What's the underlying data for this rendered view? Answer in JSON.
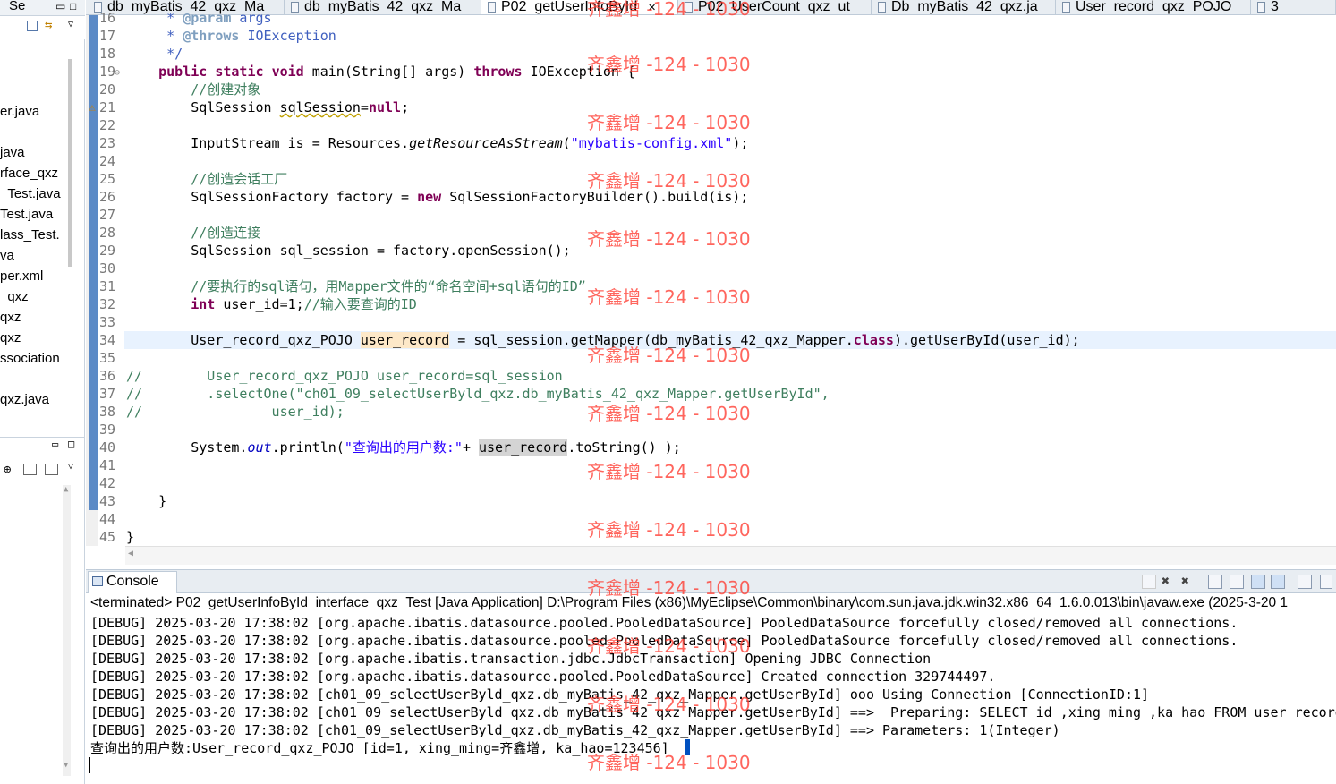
{
  "left_panel": {
    "header": "Se",
    "files": [
      "er.java",
      "",
      "java",
      "rface_qxz",
      "_Test.java",
      "Test.java",
      "lass_Test.",
      "va",
      "per.xml",
      "_qxz",
      "qxz",
      "qxz",
      "ssociation",
      "",
      "qxz.java"
    ]
  },
  "tabs": [
    "db_myBatis_42_qxz_Ma",
    "db_myBatis_42_qxz_Ma",
    "P02_getUserInfoById_",
    "P02_UserCount_qxz_ut",
    "Db_myBatis_42_qxz.ja",
    "User_record_qxz_POJO",
    "3"
  ],
  "editor": {
    "lines": [
      {
        "n": "16",
        "parts": [
          {
            "t": "     * ",
            "c": "jd"
          },
          {
            "t": "@param",
            "c": "jt"
          },
          {
            "t": " args",
            "c": "jd"
          }
        ]
      },
      {
        "n": "17",
        "parts": [
          {
            "t": "     * ",
            "c": "jd"
          },
          {
            "t": "@throws",
            "c": "jt"
          },
          {
            "t": " IOException",
            "c": "jd"
          }
        ]
      },
      {
        "n": "18",
        "parts": [
          {
            "t": "     */",
            "c": "jd"
          }
        ]
      },
      {
        "n": "19",
        "parts": [
          {
            "t": "    "
          },
          {
            "t": "public",
            "c": "kw"
          },
          {
            "t": " "
          },
          {
            "t": "static",
            "c": "kw"
          },
          {
            "t": " "
          },
          {
            "t": "void",
            "c": "kw"
          },
          {
            "t": " main(String[] args) "
          },
          {
            "t": "throws",
            "c": "kw"
          },
          {
            "t": " IOException {"
          }
        ]
      },
      {
        "n": "20",
        "parts": [
          {
            "t": "        //创建对象",
            "c": "cm"
          }
        ]
      },
      {
        "n": "21",
        "parts": [
          {
            "t": "        SqlSession "
          },
          {
            "t": "sqlSession",
            "c": "squig"
          },
          {
            "t": "="
          },
          {
            "t": "null",
            "c": "kw"
          },
          {
            "t": ";"
          }
        ]
      },
      {
        "n": "22",
        "parts": []
      },
      {
        "n": "23",
        "parts": [
          {
            "t": "        InputStream is = Resources."
          },
          {
            "t": "getResourceAsStream",
            "c": "it"
          },
          {
            "t": "("
          },
          {
            "t": "\"mybatis-config.xml\"",
            "c": "st"
          },
          {
            "t": ");"
          }
        ]
      },
      {
        "n": "24",
        "parts": []
      },
      {
        "n": "25",
        "parts": [
          {
            "t": "        //创造会话工厂",
            "c": "cm"
          }
        ]
      },
      {
        "n": "26",
        "parts": [
          {
            "t": "        SqlSessionFactory factory = "
          },
          {
            "t": "new",
            "c": "kw"
          },
          {
            "t": " SqlSessionFactoryBuilder().build(is);"
          }
        ]
      },
      {
        "n": "27",
        "parts": []
      },
      {
        "n": "28",
        "parts": [
          {
            "t": "        //创造连接",
            "c": "cm"
          }
        ]
      },
      {
        "n": "29",
        "parts": [
          {
            "t": "        SqlSession sql_session = factory.openSession();"
          }
        ]
      },
      {
        "n": "30",
        "parts": []
      },
      {
        "n": "31",
        "parts": [
          {
            "t": "        //要执行的sql语句，用Mapper文件的“命名空间+sql语句的ID”",
            "c": "cm"
          }
        ]
      },
      {
        "n": "32",
        "parts": [
          {
            "t": "        "
          },
          {
            "t": "int",
            "c": "kw"
          },
          {
            "t": " user_id=1;"
          },
          {
            "t": "//输入要查询的ID",
            "c": "cm"
          }
        ]
      },
      {
        "n": "33",
        "parts": []
      },
      {
        "n": "34",
        "cur": true,
        "parts": [
          {
            "t": "        User_record_qxz_POJO "
          },
          {
            "t": "user_record",
            "c": "ohl"
          },
          {
            "t": " = sql_session.getMapper(db_myBatis_42_qxz_Mapper."
          },
          {
            "t": "class",
            "c": "kw"
          },
          {
            "t": ").getUserById(user_id);"
          }
        ]
      },
      {
        "n": "35",
        "parts": []
      },
      {
        "n": "36",
        "parts": [
          {
            "t": "//        User_record_qxz_POJO user_record=sql_session",
            "c": "cm"
          }
        ]
      },
      {
        "n": "37",
        "parts": [
          {
            "t": "//        .selectOne(\"ch01_09_selectUserByld_qxz.db_myBatis_42_qxz_Mapper.getUserById\",",
            "c": "cm"
          }
        ]
      },
      {
        "n": "38",
        "parts": [
          {
            "t": "//                user_id);",
            "c": "cm"
          }
        ]
      },
      {
        "n": "39",
        "parts": []
      },
      {
        "n": "40",
        "parts": [
          {
            "t": "        System."
          },
          {
            "t": "out",
            "c": "fld"
          },
          {
            "t": ".println("
          },
          {
            "t": "\"查询出的用户数:\"",
            "c": "st"
          },
          {
            "t": "+ "
          },
          {
            "t": "user_record",
            "c": "hl"
          },
          {
            "t": ".toString() );"
          }
        ]
      },
      {
        "n": "41",
        "parts": []
      },
      {
        "n": "42",
        "parts": []
      },
      {
        "n": "43",
        "parts": [
          {
            "t": "    }"
          }
        ]
      },
      {
        "n": "44",
        "parts": []
      },
      {
        "n": "45",
        "parts": [
          {
            "t": "}"
          }
        ]
      }
    ]
  },
  "console": {
    "tab_label": "Console",
    "title": "<terminated> P02_getUserInfoById_interface_qxz_Test [Java Application] D:\\Program Files (x86)\\MyEclipse\\Common\\binary\\com.sun.java.jdk.win32.x86_64_1.6.0.013\\bin\\javaw.exe (2025-3-20 1",
    "lines": [
      "[DEBUG] 2025-03-20 17:38:02 [org.apache.ibatis.datasource.pooled.PooledDataSource] PooledDataSource forcefully closed/removed all connections.",
      "[DEBUG] 2025-03-20 17:38:02 [org.apache.ibatis.datasource.pooled.PooledDataSource] PooledDataSource forcefully closed/removed all connections.",
      "[DEBUG] 2025-03-20 17:38:02 [org.apache.ibatis.transaction.jdbc.JdbcTransaction] Opening JDBC Connection",
      "[DEBUG] 2025-03-20 17:38:02 [org.apache.ibatis.datasource.pooled.PooledDataSource] Created connection 329744497.",
      "[DEBUG] 2025-03-20 17:38:02 [ch01_09_selectUserByld_qxz.db_myBatis_42_qxz_Mapper.getUserById] ooo Using Connection [ConnectionID:1]",
      "[DEBUG] 2025-03-20 17:38:02 [ch01_09_selectUserByld_qxz.db_myBatis_42_qxz_Mapper.getUserById] ==>  Preparing: SELECT id ,xing_ming ,ka_hao FROM user_record",
      "[DEBUG] 2025-03-20 17:38:02 [ch01_09_selectUserByld_qxz.db_myBatis_42_qxz_Mapper.getUserById] ==> Parameters: 1(Integer)",
      "查询出的用户数:User_record_qxz_POJO [id=1, xing_ming=齐鑫增, ka_hao=123456]"
    ]
  },
  "watermark": "齐鑫增 -124 - 1030"
}
